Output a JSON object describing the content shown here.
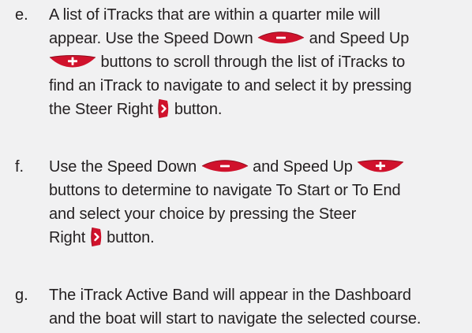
{
  "steps": [
    {
      "letter": "e.",
      "lines": [
        {
          "t1": "A list of iTracks that are within a quarter mile will"
        },
        {
          "t1": "appear. Use the Speed Down ",
          "t2": " and Speed Up"
        },
        {
          "t2": " buttons to scroll through the list of iTracks to"
        },
        {
          "t1": "find an iTrack to navigate to and select it by pressing"
        },
        {
          "t1": "the Steer Right ",
          "t2": " button."
        }
      ]
    },
    {
      "letter": "f.",
      "lines": [
        {
          "t1": "Use the Speed Down ",
          "t2": " and Speed Up "
        },
        {
          "t1": "buttons to determine to navigate To Start or To End"
        },
        {
          "t1": "and select your choice by pressing the Steer"
        },
        {
          "t1": "Right ",
          "t2": " button."
        }
      ]
    },
    {
      "letter": "g.",
      "lines": [
        {
          "t1": "The iTrack Active Band will appear in the Dashboard"
        },
        {
          "t1": "and the boat will start to navigate the selected course."
        }
      ]
    }
  ],
  "icons": {
    "speed_down": "speed-down-button-icon",
    "speed_up": "speed-up-button-icon",
    "steer_right": "steer-right-button-icon"
  },
  "colors": {
    "icon_red": "#d0122c",
    "icon_dark_red": "#8e0c1c",
    "icon_white": "#ffffff",
    "text": "#231f20",
    "background": "#f1f1f2"
  }
}
